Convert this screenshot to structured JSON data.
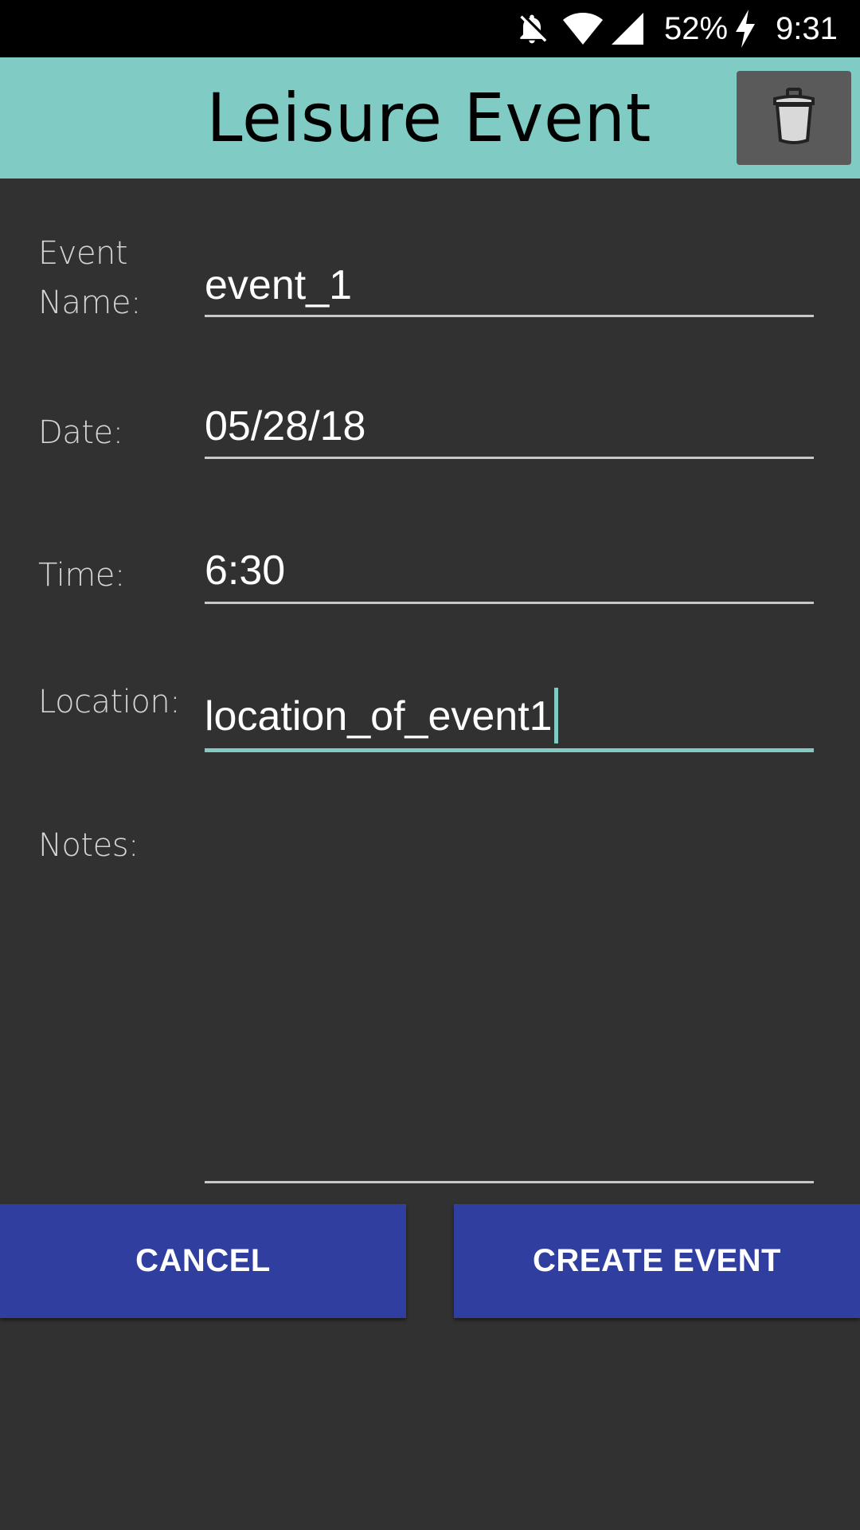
{
  "status_bar": {
    "battery": "52%",
    "time": "9:31",
    "icons": [
      "notifications-off-icon",
      "wifi-icon",
      "cell-signal-icon",
      "charging-bolt-icon"
    ]
  },
  "app_bar": {
    "title": "Leisure Event",
    "delete_icon": "trash-icon",
    "background": "#80cbc4"
  },
  "form": {
    "event_name": {
      "label_line1": "Event",
      "label_line2": "Name:",
      "value": "event_1"
    },
    "date": {
      "label": "Date:",
      "value": "05/28/18"
    },
    "time": {
      "label": "Time:",
      "value": "6:30"
    },
    "location": {
      "label": "Location:",
      "value": "location_of_event1"
    },
    "notes": {
      "label": "Notes:",
      "value": ""
    }
  },
  "buttons": {
    "cancel": "CANCEL",
    "create": "CREATE EVENT",
    "color": "#303f9f"
  },
  "colors": {
    "background": "#313131",
    "accent": "#80cbc4"
  }
}
